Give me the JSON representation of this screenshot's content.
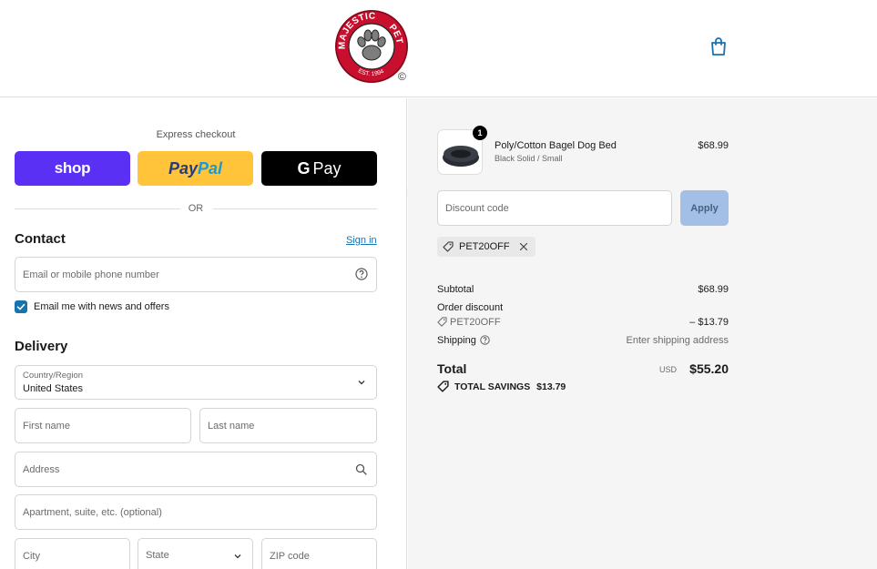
{
  "header": {
    "logo_text_top": "MAJESTIC",
    "logo_text_right": "PET",
    "logo_text_bottom": "EST. 1994",
    "logo_copyright": "©",
    "cart_icon": "shopping-bag-icon"
  },
  "express": {
    "title": "Express checkout",
    "shop_label": "shop",
    "paypal_label_1": "Pay",
    "paypal_label_2": "Pal",
    "gpay_label_g": "G",
    "gpay_label": "Pay",
    "or_label": "OR"
  },
  "contact": {
    "heading": "Contact",
    "signin_label": "Sign in",
    "email_placeholder": "Email or mobile phone number",
    "newsletter_label": "Email me with news and offers",
    "newsletter_checked": true
  },
  "delivery": {
    "heading": "Delivery",
    "country_label": "Country/Region",
    "country_value": "United States",
    "first_name_placeholder": "First name",
    "last_name_placeholder": "Last name",
    "address_placeholder": "Address",
    "apartment_placeholder": "Apartment, suite, etc. (optional)",
    "city_placeholder": "City",
    "state_placeholder": "State",
    "zip_placeholder": "ZIP code"
  },
  "order": {
    "item": {
      "quantity": "1",
      "name": "Poly/Cotton Bagel Dog Bed",
      "variant": "Black Solid / Small",
      "price": "$68.99"
    },
    "discount_placeholder": "Discount code",
    "apply_label": "Apply",
    "applied_code": "PET20OFF",
    "subtotal_label": "Subtotal",
    "subtotal_value": "$68.99",
    "order_discount_label": "Order discount",
    "order_discount_code": "PET20OFF",
    "order_discount_value": "– $13.79",
    "shipping_label": "Shipping",
    "shipping_value": "Enter shipping address",
    "total_label": "Total",
    "total_currency": "USD",
    "total_value": "$55.20",
    "savings_label": "TOTAL SAVINGS",
    "savings_value": "$13.79"
  },
  "colors": {
    "shop_purple": "#5a31f4",
    "paypal_yellow": "#ffc439",
    "link_blue": "#1773b0",
    "apply_disabled": "#a3bfe6"
  }
}
